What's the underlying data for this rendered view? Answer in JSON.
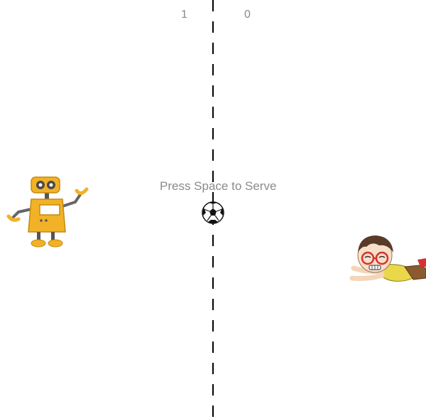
{
  "game": {
    "score_left": "1",
    "score_right": "0",
    "prompt": "Press Space to Serve"
  },
  "sprites": {
    "left_player": "robot-icon",
    "right_player": "kid-icon",
    "ball": "soccer-ball-icon"
  },
  "colors": {
    "background": "#ffffff",
    "text": "#8a8a8a",
    "center_line": "#000000",
    "robot_body": "#f2b227",
    "kid_glasses": "#d93030"
  }
}
